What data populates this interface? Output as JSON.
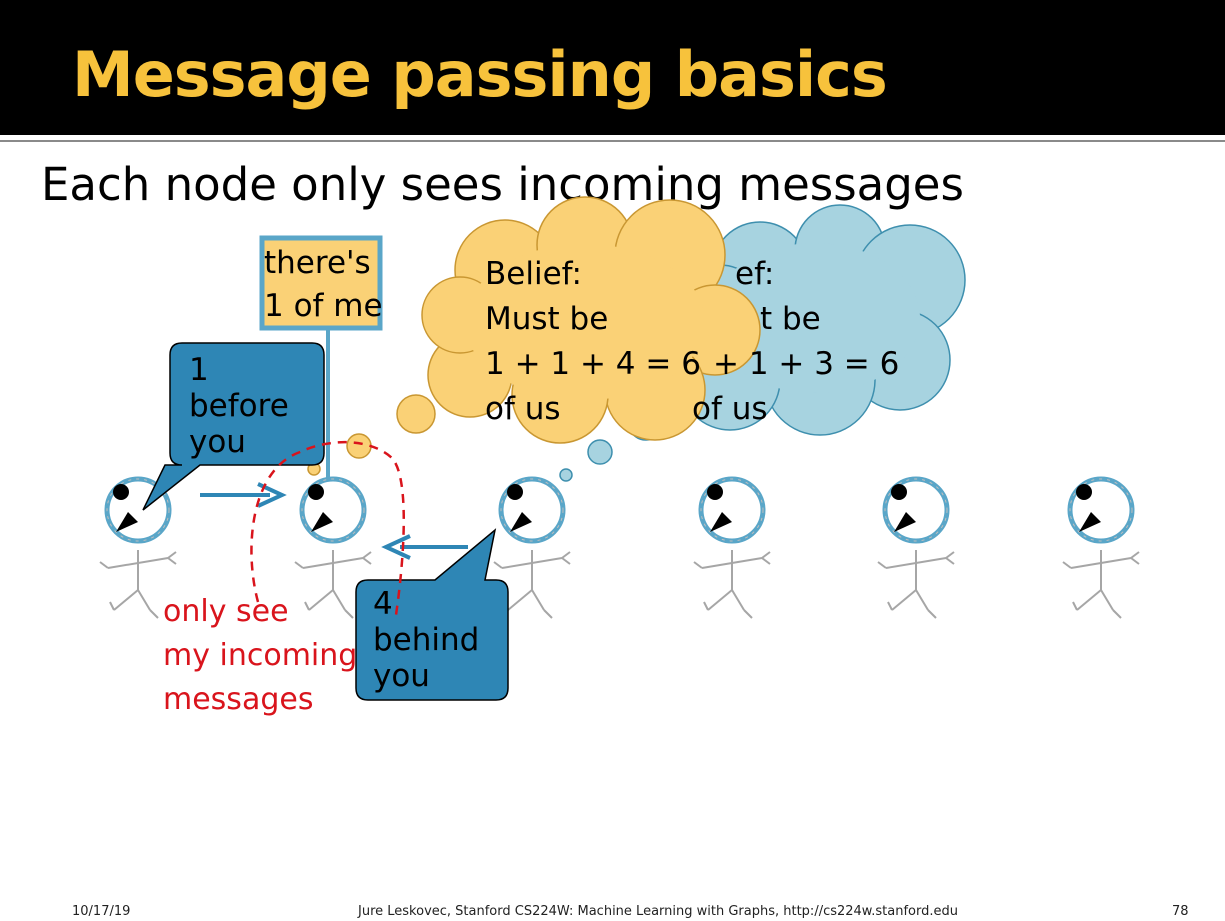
{
  "slide": {
    "title": "Message passing basics",
    "subtitle": "Each node only sees incoming messages"
  },
  "notes": {
    "self_box": [
      "there's",
      "1 of me"
    ],
    "before_callout": [
      "1",
      "before",
      "you"
    ],
    "behind_callout": [
      "4",
      "behind",
      "you"
    ],
    "incoming_label": [
      "only see",
      "my incoming",
      "messages"
    ]
  },
  "beliefs": {
    "orange": [
      "Belief:",
      "Must be",
      "1 + 1 + 4 = 6",
      "of us"
    ],
    "blue": [
      "ef:",
      "t be",
      "+ 1 + 3 = 6",
      "of us"
    ]
  },
  "colors": {
    "header_bg": "#000000",
    "title": "#f7c23c",
    "callout_fill": "#2e86b5",
    "orange_cloud": "#fad176",
    "blue_cloud": "#a7d3e0",
    "incoming_red": "#d9141c",
    "node_ring": "#5aa6c8"
  },
  "footer": {
    "date": "10/17/19",
    "credit": "Jure Leskovec, Stanford CS224W: Machine Learning with Graphs, http://cs224w.stanford.edu",
    "page": "78"
  }
}
